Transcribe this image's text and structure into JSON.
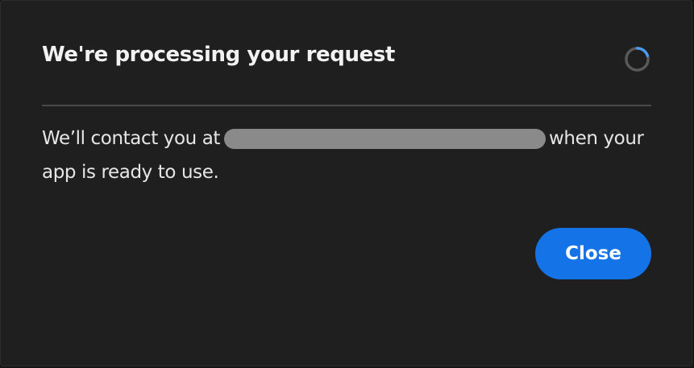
{
  "dialog": {
    "title": "We're processing your request",
    "message_before": "We’ll contact you at",
    "message_after": "when your",
    "message_line2": "app is ready to use.",
    "close_label": "Close",
    "loading_icon": "spinner-icon",
    "colors": {
      "background": "#1f1f20",
      "accent": "#1473e6",
      "spinner_track": "#5a5a5a",
      "spinner_arc": "#4a9cf0",
      "redaction": "#8a8a8a"
    }
  }
}
